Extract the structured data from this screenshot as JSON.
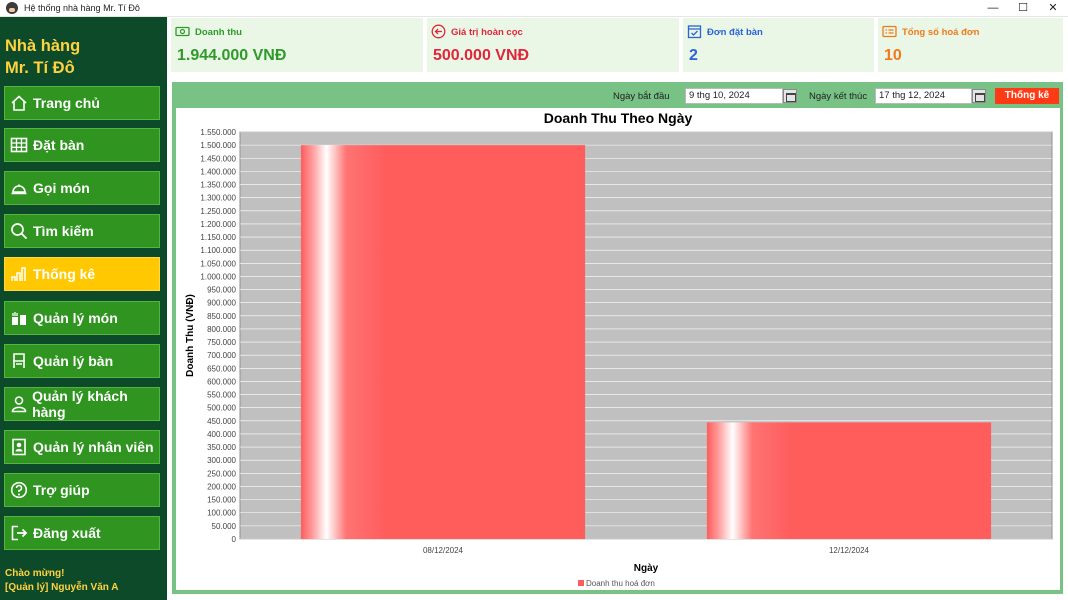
{
  "window": {
    "title": "Hệ thống nhà hàng Mr. Tí Đô",
    "minimize": "—",
    "maximize": "☐",
    "close": "✕"
  },
  "sidebar": {
    "brand_line1": "Nhà hàng",
    "brand_line2": "Mr. Tí Đô",
    "items": [
      {
        "label": "Trang chủ",
        "icon": "home-icon"
      },
      {
        "label": "Đặt bàn",
        "icon": "table-grid-icon"
      },
      {
        "label": "Gọi món",
        "icon": "food-cloche-icon"
      },
      {
        "label": "Tìm kiếm",
        "icon": "search-icon"
      },
      {
        "label": "Thống kê",
        "icon": "bar-chart-icon"
      },
      {
        "label": "Quản lý món",
        "icon": "dish-icon"
      },
      {
        "label": "Quản lý bàn",
        "icon": "chair-icon"
      },
      {
        "label": "Quản lý khách hàng",
        "icon": "user-icon"
      },
      {
        "label": "Quản lý nhân viên",
        "icon": "id-badge-icon"
      },
      {
        "label": "Trợ giúp",
        "icon": "help-icon"
      },
      {
        "label": "Đăng xuất",
        "icon": "logout-icon"
      }
    ],
    "active_index": 4,
    "greeting_line1": "Chào mừng!",
    "greeting_line2": "[Quản lý] Nguyễn Văn A"
  },
  "stats": [
    {
      "label": "Doanh thu",
      "value": "1.944.000 VNĐ",
      "color": "#2f9a2a",
      "icon": "money-icon"
    },
    {
      "label": "Giá trị hoàn cọc",
      "value": "500.000 VNĐ",
      "color": "#e0263a",
      "icon": "refund-icon"
    },
    {
      "label": "Đơn đặt bàn",
      "value": "2",
      "color": "#2a64d6",
      "icon": "booking-icon"
    },
    {
      "label": "Tổng số hoá đơn",
      "value": "10",
      "color": "#f07a1a",
      "icon": "invoice-icon"
    }
  ],
  "filters": {
    "start_label": "Ngày bắt đầu",
    "start_value": "9 thg 10, 2024",
    "end_label": "Ngày kết thúc",
    "end_value": "17 thg 12, 2024",
    "submit_label": "Thống kê"
  },
  "chart_data": {
    "type": "bar",
    "title": "Doanh Thu Theo Ngày",
    "xlabel": "Ngày",
    "ylabel": "Doanh Thu (VNĐ)",
    "categories": [
      "08/12/2024",
      "12/12/2024"
    ],
    "series": [
      {
        "name": "Doanh thu hoá đơn",
        "values": [
          1500000,
          444000
        ]
      }
    ],
    "ylim": [
      0,
      1550000
    ],
    "ytick_step": 50000,
    "ytick_labels": [
      "0",
      "50.000",
      "100.000",
      "150.000",
      "200.000",
      "250.000",
      "300.000",
      "350.000",
      "400.000",
      "450.000",
      "500.000",
      "550.000",
      "600.000",
      "650.000",
      "700.000",
      "750.000",
      "800.000",
      "850.000",
      "900.000",
      "950.000",
      "1.000.000",
      "1.050.000",
      "1.100.000",
      "1.150.000",
      "1.200.000",
      "1.250.000",
      "1.300.000",
      "1.350.000",
      "1.400.000",
      "1.450.000",
      "1.500.000",
      "1.550.000"
    ],
    "grid": true,
    "legend": "bottom",
    "bar_color": "#ff5c5c",
    "plot_bg": "#c0c0c0"
  }
}
